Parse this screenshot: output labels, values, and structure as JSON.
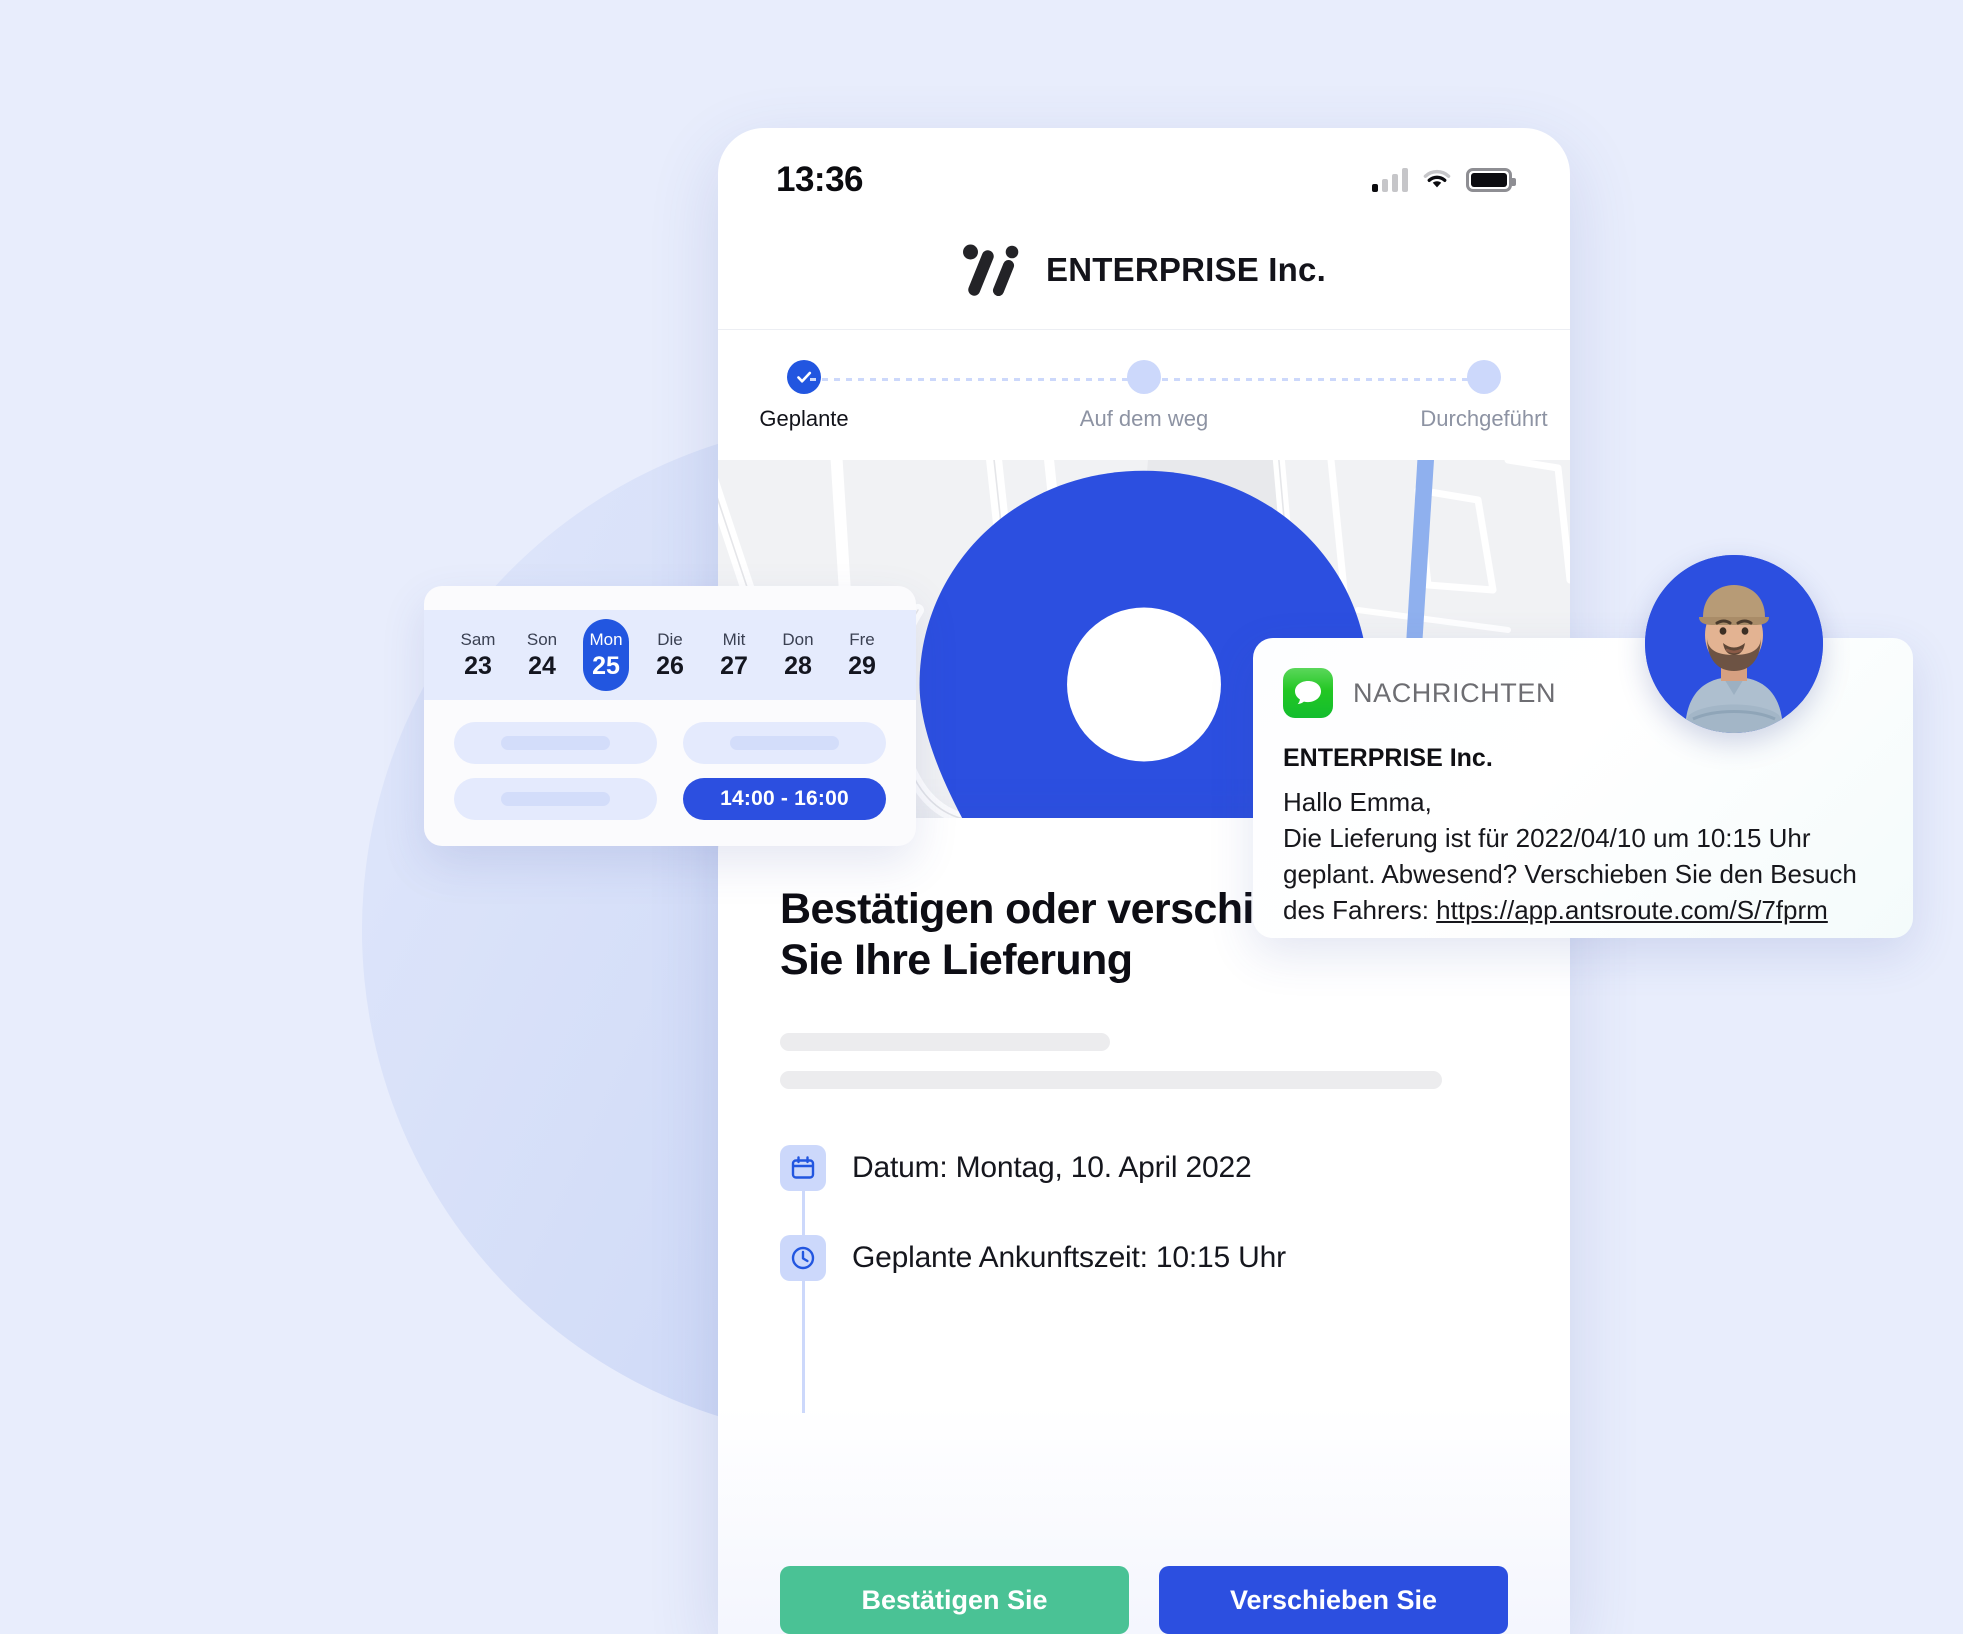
{
  "theme": {
    "page_bg": "#e8edfc",
    "circle_bg": "#c9d5f6",
    "accent_blue": "#2256e0",
    "button_blue": "#2c4fe0",
    "confirm_green": "#4ac295",
    "messages_green": "#23c723",
    "map_bg": "#f1f2f4",
    "water_blue": "#8fb0ee"
  },
  "phone": {
    "status_bar": {
      "time": "13:36",
      "signal_icon": "cellular-bars-icon",
      "wifi_icon": "wifi-icon",
      "battery_icon": "battery-icon"
    },
    "brand": {
      "logo_icon": "enterprise-logo-icon",
      "name": "ENTERPRISE Inc."
    },
    "stepper": {
      "steps": [
        {
          "label": "Geplante",
          "state": "done",
          "icon": "check-icon"
        },
        {
          "label": "Auf dem weg",
          "state": "upcoming",
          "icon": "dot-icon"
        },
        {
          "label": "Durchgeführt",
          "state": "upcoming",
          "icon": "dot-icon"
        }
      ]
    },
    "map": {
      "pin_icon": "map-pin-icon"
    },
    "sheet": {
      "title_line1": "Bestätigen oder verschieben",
      "title_line2": "Sie Ihre Lieferung",
      "details": [
        {
          "icon": "calendar-icon",
          "text": "Datum: Montag, 10. April 2022"
        },
        {
          "icon": "clock-icon",
          "text": "Geplante Ankunftszeit: 10:15 Uhr"
        }
      ],
      "buttons": {
        "confirm": "Bestätigen Sie",
        "reschedule": "Verschieben Sie"
      }
    }
  },
  "calendar_card": {
    "days": [
      {
        "dow": "Sam",
        "num": "23",
        "selected": false
      },
      {
        "dow": "Son",
        "num": "24",
        "selected": false
      },
      {
        "dow": "Mon",
        "num": "25",
        "selected": true
      },
      {
        "dow": "Die",
        "num": "26",
        "selected": false
      },
      {
        "dow": "Mit",
        "num": "27",
        "selected": false
      },
      {
        "dow": "Don",
        "num": "28",
        "selected": false
      },
      {
        "dow": "Fre",
        "num": "29",
        "selected": false
      }
    ],
    "slots": [
      {
        "label": "",
        "chosen": false
      },
      {
        "label": "",
        "chosen": false
      },
      {
        "label": "",
        "chosen": false
      },
      {
        "label": "14:00 - 16:00",
        "chosen": true
      }
    ]
  },
  "notification": {
    "app_icon": "messages-icon",
    "app_name": "NACHRICHTEN",
    "sender": "ENTERPRISE Inc.",
    "line1": "Hallo Emma,",
    "line2": "Die Lieferung ist für 2022/04/10 um 10:15 Uhr",
    "line3": "geplant. Abwesend? Verschieben Sie den Besuch",
    "line4_prefix": "des Fahrers: ",
    "link": "https://app.antsroute.com/S/7fprm"
  },
  "avatar": {
    "name": "driver-avatar",
    "alt": "Delivery driver portrait"
  }
}
